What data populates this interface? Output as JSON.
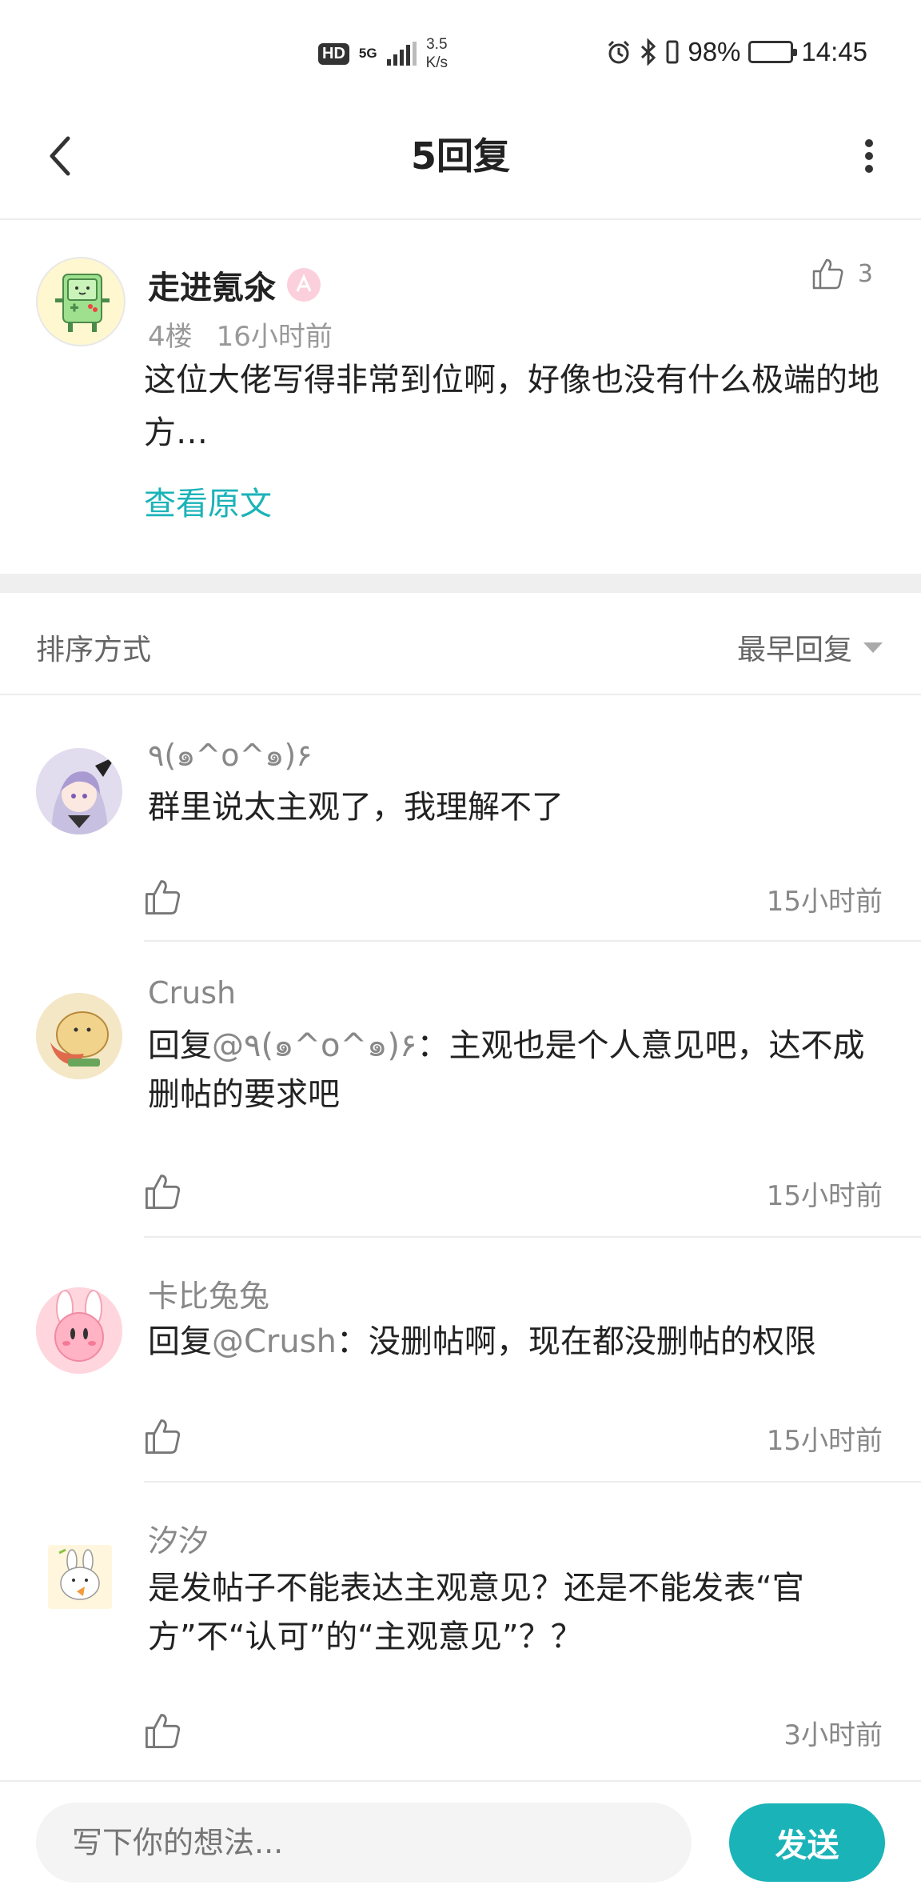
{
  "status_bar": {
    "hd": "HD",
    "network": "5G",
    "speed_value": "3.5",
    "speed_unit": "K/s",
    "battery": "98%",
    "time": "14:45"
  },
  "header": {
    "title": "5回复"
  },
  "post": {
    "author": "走进氪氽",
    "like_count": "3",
    "floor": "4楼",
    "time": "16小时前",
    "text": "这位大佬写得非常到位啊，好像也没有什么极端的地方…",
    "view_original": "查看原文"
  },
  "sort": {
    "label": "排序方式",
    "selected": "最早回复"
  },
  "replies": [
    {
      "name": "٩(๑^o^๑)۶",
      "text": "群里说太主观了，我理解不了",
      "reply_to": "",
      "time": "15小时前"
    },
    {
      "name": "Crush",
      "reply_prefix": "回复",
      "reply_to": "@٩(๑^o^๑)۶",
      "text": "：主观也是个人意见吧，达不成删帖的要求吧",
      "time": "15小时前"
    },
    {
      "name": "卡比兔兔",
      "reply_prefix": "回复",
      "reply_to": "@Crush",
      "text": "：没删帖啊，现在都没删帖的权限",
      "time": "15小时前"
    },
    {
      "name": "汐汐",
      "text": "是发帖子不能表达主观意见？还是不能发表“官方”不“认可”的“主观意见”？？",
      "reply_to": "",
      "time": "3小时前"
    }
  ],
  "composer": {
    "placeholder": "写下你的想法...",
    "send_label": "发送"
  },
  "colors": {
    "accent": "#1ab3b8",
    "muted_text": "#888888",
    "divider": "#ececec"
  },
  "icons": [
    "back-icon",
    "more-icon",
    "thumbs-up-icon",
    "alarm-icon",
    "bluetooth-icon",
    "signal-icon",
    "battery-icon",
    "sort-dropdown-icon"
  ]
}
